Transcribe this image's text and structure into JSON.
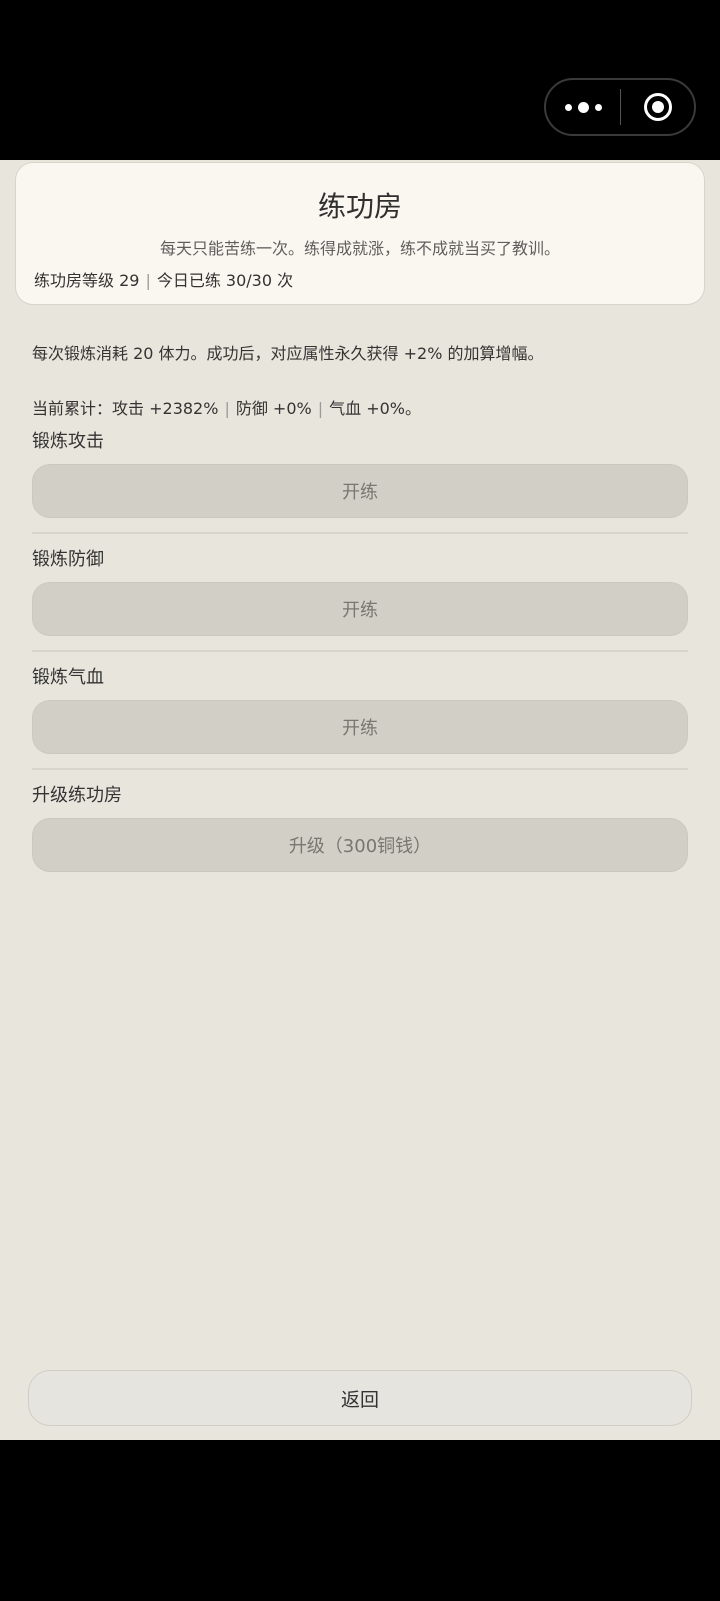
{
  "header": {
    "title": "练功房",
    "subtitle": "每天只能苦练一次。练得成就涨，练不成就当买了教训。",
    "level_text": "练功房等级 29",
    "separator": "|",
    "daily_text": "今日已练 30/30 次"
  },
  "info": {
    "cost_text": "每次锻炼消耗 20 体力。成功后，对应属性永久获得 +2% 的加算增幅。",
    "cumulative_prefix": "当前累计：",
    "attack_total": "攻击 +2382%",
    "defense_total": "防御 +0%",
    "hp_total": "气血 +0%。",
    "separator": "|"
  },
  "sections": {
    "attack": {
      "label": "锻炼攻击",
      "button": "开练"
    },
    "defense": {
      "label": "锻炼防御",
      "button": "开练"
    },
    "hp": {
      "label": "锻炼气血",
      "button": "开练"
    },
    "upgrade": {
      "label": "升级练功房",
      "button": "升级（300铜钱）"
    }
  },
  "footer": {
    "back_label": "返回"
  },
  "capsule": {
    "more_icon": "more-dots-icon",
    "close_icon": "target-close-icon"
  },
  "colors": {
    "page_bg": "#e8e6dc",
    "card_bg": "#faf7f0",
    "button_disabled_bg": "#d2cfc6",
    "button_disabled_text": "#7a7670"
  }
}
